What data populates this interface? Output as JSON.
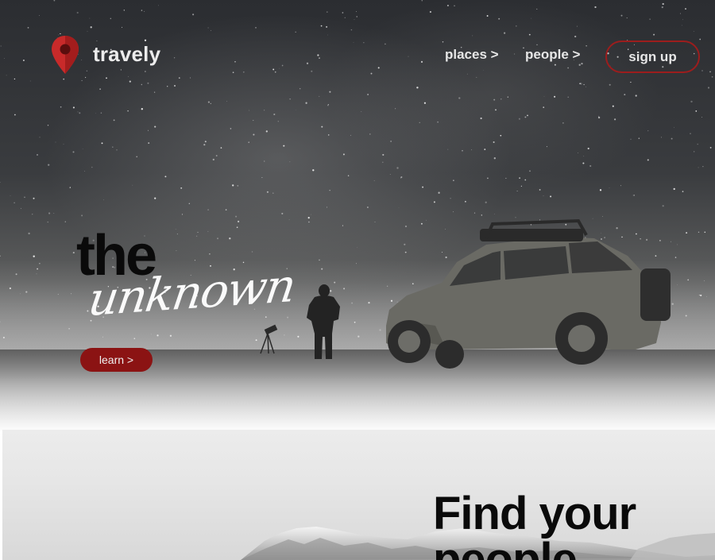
{
  "brand": {
    "name": "travely",
    "accent_color": "#9c1d1d",
    "logo_icon": "map-pin-icon"
  },
  "nav": {
    "places": "places >",
    "people": "people >",
    "signup": "sign up"
  },
  "hero": {
    "headline_top": "the",
    "headline_script": "unknown",
    "cta": "learn >"
  },
  "section2": {
    "title_line1": "Find your",
    "title_line2": "people"
  }
}
